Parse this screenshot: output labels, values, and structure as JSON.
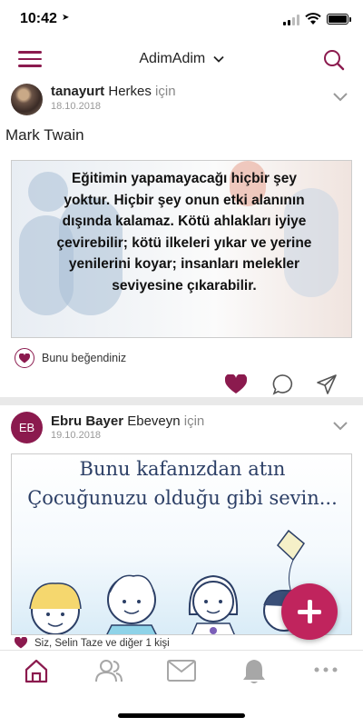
{
  "status_bar": {
    "time": "10:42",
    "location_glyph": "➤"
  },
  "navbar": {
    "title": "AdimAdim"
  },
  "posts": [
    {
      "author": "tanayurt",
      "audience": "Herkes",
      "for_word": "için",
      "date": "18.10.2018",
      "caption": "Mark Twain",
      "quote": "Eğitimin yapamayacağı hiçbir şey yoktur. Hiçbir şey onun etki alanının dışında kalamaz. Kötü ahlakları iyiye çevirebilir; kötü ilkeleri yıkar ve yerine yenilerini koyar; insanları melekler seviyesine çıkarabilir.",
      "like_text": "Bunu beğendiniz"
    },
    {
      "author": "Ebru Bayer",
      "audience": "Ebeveyn",
      "for_word": "için",
      "date": "19.10.2018",
      "avatar_initials": "EB",
      "image_line_1": "Bunu kafanızdan atın",
      "image_line_2": "Çocuğunuzu olduğu gibi sevin...",
      "like_text": "Siz, Selin Taze ve diğer 1 kişi"
    }
  ],
  "colors": {
    "accent": "#8b1a4e",
    "fab": "#c0245d",
    "icon_gray": "#a7a7a7"
  },
  "tabs": [
    "home-icon",
    "people-icon",
    "mail-icon",
    "bell-icon",
    "more-icon"
  ]
}
